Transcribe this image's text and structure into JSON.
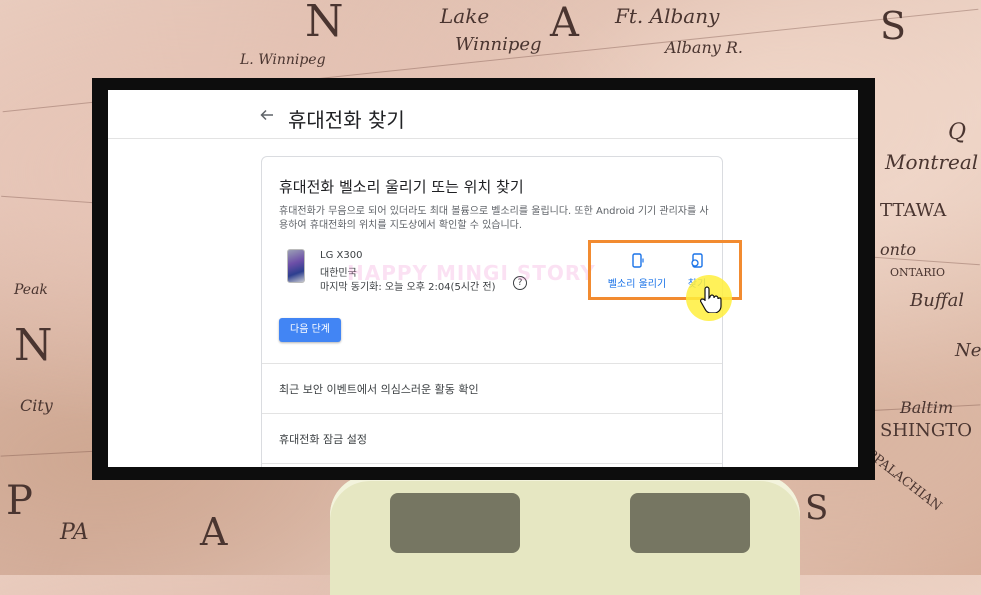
{
  "background": {
    "map_labels": [
      "N",
      "Lake",
      "Winnipeg",
      "L. Winnipeg",
      "Ft. Albany",
      "Albany R.",
      "A",
      "S",
      "Q",
      "Montreal",
      "TTAWA",
      "onto",
      "ONTARIO",
      "Buffal",
      "Ne",
      "Baltim",
      "SHINGTO",
      "APPALACHIAN",
      "N",
      "City",
      "P",
      "A",
      "Peak",
      "S",
      "PA"
    ],
    "watermark": "HAPPY MINGI STORY"
  },
  "page": {
    "title": "휴대전화 찾기"
  },
  "card": {
    "title": "휴대전화 벨소리 울리기 또는 위치 찾기",
    "description": "휴대전화가 무음으로 되어 있더라도 최대 볼륨으로 벨소리를 울립니다. 또한 Android 기기 관리자를 사용하여 휴대전화의 위치를 지도상에서 확인할 수 있습니다.",
    "device": {
      "name": "LG X300",
      "country": "대한민국",
      "last_sync": "마지막 동기화: 오늘 오후 2:04(5시간 전)",
      "help_icon": "help-circle-icon",
      "help_glyph": "?"
    },
    "actions": {
      "ring_label": "벨소리 울리기",
      "find_label": "찾기"
    },
    "next_button": "다음 단계"
  },
  "list": {
    "items": [
      {
        "label": "최근 보안 이벤트에서 의심스러운 활동 확인"
      },
      {
        "label": "휴대전화 잠금 설정"
      }
    ]
  },
  "colors": {
    "accent": "#1a73e8",
    "button": "#4285f4",
    "highlight": "#f28b30",
    "cursor_glow": "#ffee3c"
  }
}
